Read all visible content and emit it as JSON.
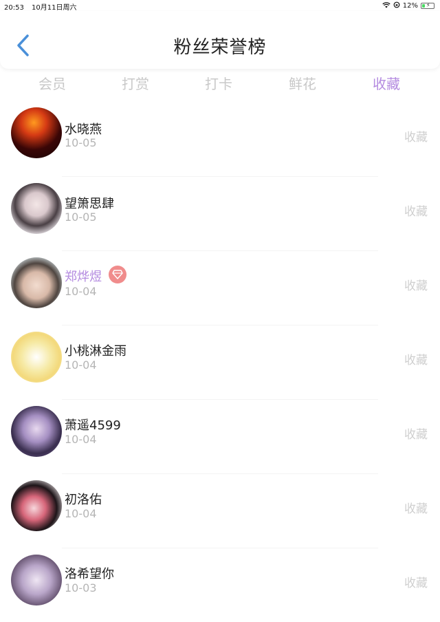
{
  "status": {
    "time": "20:53",
    "date": "10月11日周六",
    "battery": "12%"
  },
  "header": {
    "title": "粉丝荣誉榜"
  },
  "tabs": [
    {
      "label": "会员"
    },
    {
      "label": "打赏"
    },
    {
      "label": "打卡"
    },
    {
      "label": "鲜花"
    },
    {
      "label": "收藏",
      "active": true
    }
  ],
  "rows": [
    {
      "name": "水晓燕",
      "date": "10-05",
      "action": "收藏"
    },
    {
      "name": "望箫思肆",
      "date": "10-05",
      "action": "收藏"
    },
    {
      "name": "郑烨煜",
      "date": "10-04",
      "action": "收藏",
      "vip": true
    },
    {
      "name": "小桃淋金雨",
      "date": "10-04",
      "action": "收藏"
    },
    {
      "name": "萧遥4599",
      "date": "10-04",
      "action": "收藏"
    },
    {
      "name": "初洛佑",
      "date": "10-04",
      "action": "收藏"
    },
    {
      "name": "洛希望你",
      "date": "10-03",
      "action": "收藏"
    }
  ],
  "colors": {
    "accent": "#b48be0",
    "inactive_tab": "#c8c8c8",
    "action": "#cfcfcf",
    "back_arrow": "#4a90d9"
  }
}
